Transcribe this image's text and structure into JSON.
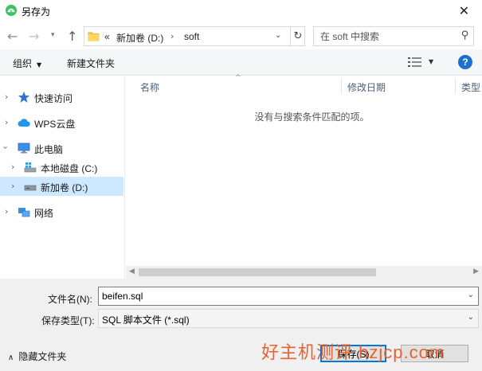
{
  "window": {
    "title": "另存为",
    "close_glyph": "✕"
  },
  "address_bar": {
    "crumbs": [
      "«",
      "新加卷 (D:)",
      "soft"
    ],
    "search_placeholder": "在 soft 中搜索"
  },
  "toolbar": {
    "organize_label": "组织",
    "new_folder_label": "新建文件夹",
    "help_label": "?"
  },
  "nav_pane": {
    "items": [
      {
        "label": "快速访问",
        "icon": "star-pin-icon",
        "level": 0,
        "expanded": false
      },
      {
        "label": "WPS云盘",
        "icon": "cloud-icon",
        "level": 0,
        "expanded": false
      },
      {
        "label": "此电脑",
        "icon": "computer-icon",
        "level": 0,
        "expanded": true
      },
      {
        "label": "本地磁盘 (C:)",
        "icon": "windows-drive-icon",
        "level": 1,
        "expanded": false
      },
      {
        "label": "新加卷 (D:)",
        "icon": "drive-icon",
        "level": 1,
        "expanded": false,
        "selected": true
      },
      {
        "label": "网络",
        "icon": "network-icon",
        "level": 0,
        "expanded": false
      }
    ]
  },
  "content": {
    "columns": [
      "名称",
      "修改日期",
      "类型"
    ],
    "empty_message": "没有与搜索条件匹配的项。"
  },
  "bottom": {
    "filename_label": "文件名(N):",
    "filename_value": "beifen.sql",
    "filetype_label": "保存类型(T):",
    "filetype_value": "SQL 脚本文件 (*.sql)",
    "hide_folders_label": "隐藏文件夹",
    "save_label": "保存(S)",
    "cancel_label": "取消"
  },
  "watermark": "好主机测评 hzjcp.com",
  "colors": {
    "accent": "#0078d7",
    "selection": "#cde8ff",
    "help": "#1f6fcf",
    "watermark": "#e8622e"
  }
}
